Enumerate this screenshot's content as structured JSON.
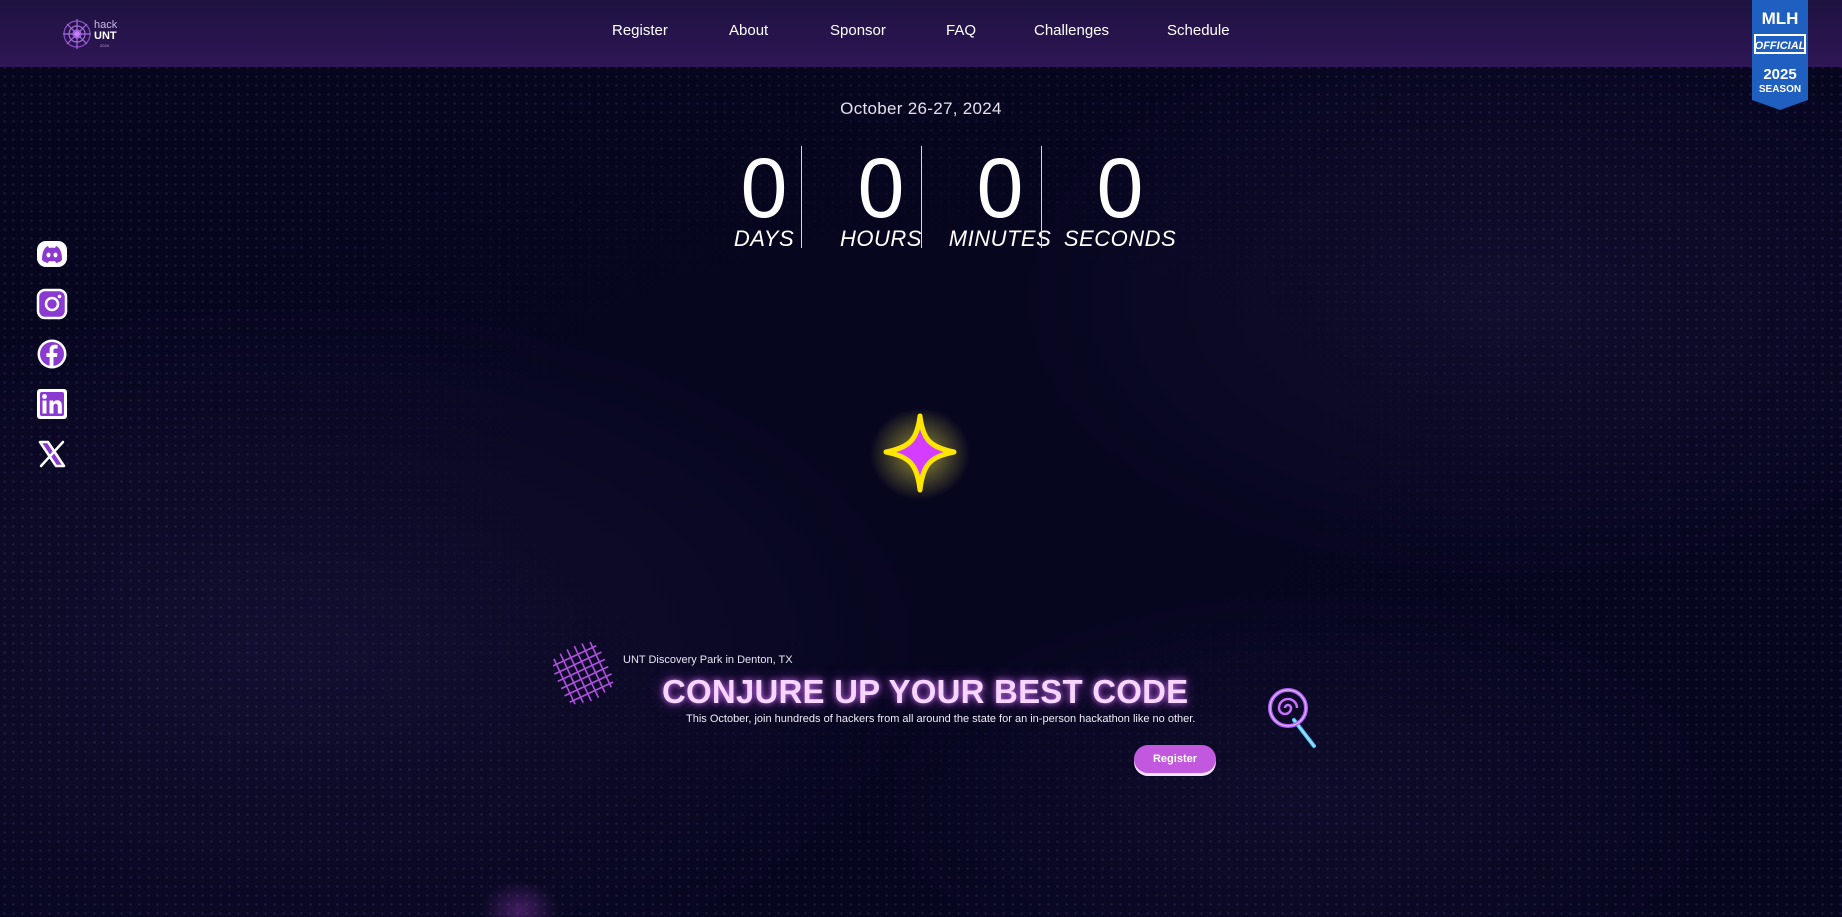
{
  "nav": {
    "logo": {
      "text_top": "hack",
      "text_bottom": "UNT",
      "year": "2024"
    },
    "links": [
      {
        "label": "Register"
      },
      {
        "label": "About"
      },
      {
        "label": "Sponsor"
      },
      {
        "label": "FAQ"
      },
      {
        "label": "Challenges"
      },
      {
        "label": "Schedule"
      }
    ]
  },
  "mlh_badge": {
    "top": "MLH",
    "middle": "OFFICIAL",
    "year": "2025",
    "bottom": "SEASON",
    "color": "#1f5fbf"
  },
  "event": {
    "date": "October 26-27, 2024"
  },
  "countdown": [
    {
      "value": "0",
      "label": "DAYS"
    },
    {
      "value": "0",
      "label": "HOURS"
    },
    {
      "value": "0",
      "label": "MINUTES"
    },
    {
      "value": "0",
      "label": "SECONDS"
    }
  ],
  "social": [
    {
      "icon": "discord-icon"
    },
    {
      "icon": "instagram-icon"
    },
    {
      "icon": "facebook-icon"
    },
    {
      "icon": "linkedin-icon"
    },
    {
      "icon": "x-icon"
    }
  ],
  "hero": {
    "location": "UNT Discovery Park in Denton, TX",
    "headline": "CONJURE UP YOUR BEST CODE",
    "subtext": "This October, join hundreds of hackers from all around the state for an in-person hackathon like no other.",
    "cta_label": "Register"
  },
  "colors": {
    "background": "#07061f",
    "nav_gradient_top": "#1e1240",
    "nav_gradient_bottom": "#2f1656",
    "accent_purple": "#c258dd",
    "sparkle_yellow": "#ffe600",
    "sparkle_pink": "#d43cff",
    "headline_glow": "#f6d6ff",
    "icon_purple": "#8a3ad0"
  }
}
